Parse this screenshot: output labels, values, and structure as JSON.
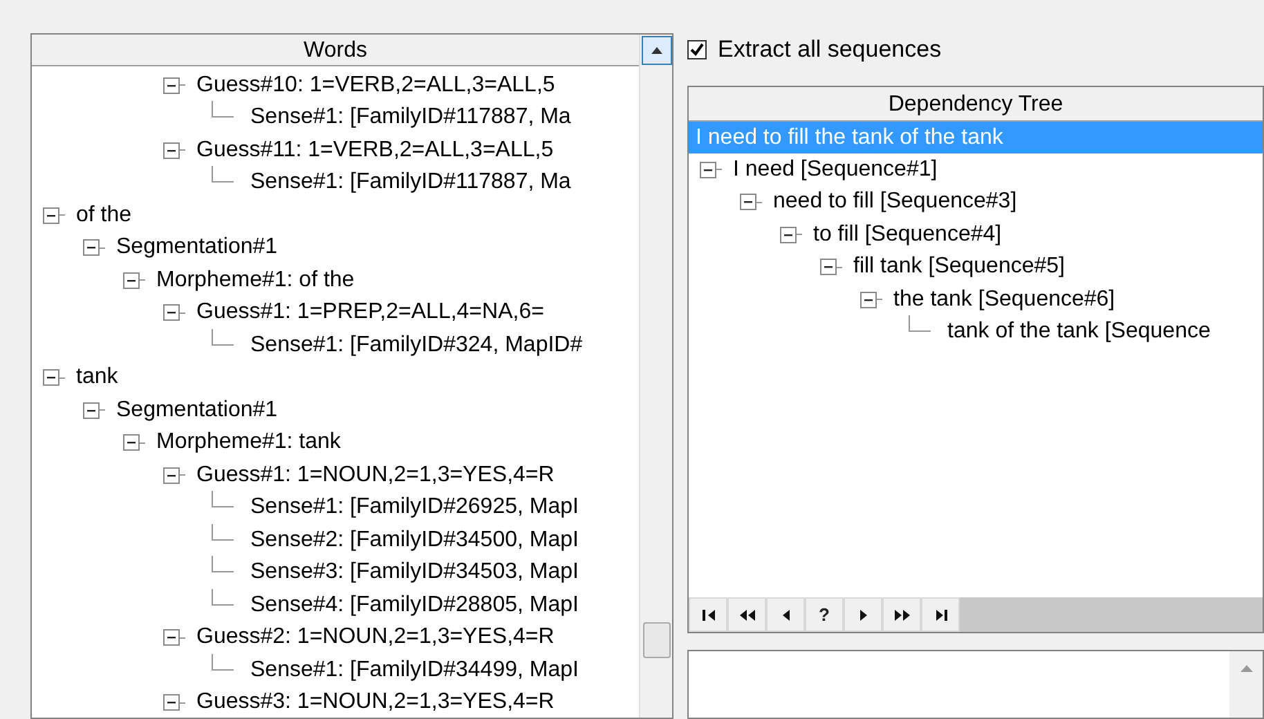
{
  "words_panel": {
    "title": "Words",
    "nodes": [
      {
        "children": [
          {
            "children": [
              {
                "children": [
                  {
                    "label": "Guess#10: 1=VERB,2=ALL,3=ALL,5",
                    "expanded": true,
                    "children": [
                      {
                        "label": "Sense#1: [FamilyID#117887, Ma"
                      }
                    ]
                  },
                  {
                    "label": "Guess#11: 1=VERB,2=ALL,3=ALL,5",
                    "expanded": true,
                    "children": [
                      {
                        "label": "Sense#1: [FamilyID#117887, Ma"
                      }
                    ]
                  }
                ]
              }
            ]
          }
        ]
      },
      {
        "label": "of the",
        "expanded": true,
        "children": [
          {
            "label": "Segmentation#1",
            "expanded": true,
            "children": [
              {
                "label": "Morpheme#1: of the",
                "expanded": true,
                "children": [
                  {
                    "label": "Guess#1: 1=PREP,2=ALL,4=NA,6=",
                    "expanded": true,
                    "children": [
                      {
                        "label": "Sense#1: [FamilyID#324, MapID#"
                      }
                    ]
                  }
                ]
              }
            ]
          }
        ]
      },
      {
        "label": "tank",
        "expanded": true,
        "children": [
          {
            "label": "Segmentation#1",
            "expanded": true,
            "children": [
              {
                "label": "Morpheme#1: tank",
                "expanded": true,
                "children": [
                  {
                    "label": "Guess#1: 1=NOUN,2=1,3=YES,4=R",
                    "expanded": true,
                    "children": [
                      {
                        "label": "Sense#1: [FamilyID#26925, MapI"
                      },
                      {
                        "label": "Sense#2: [FamilyID#34500, MapI"
                      },
                      {
                        "label": "Sense#3: [FamilyID#34503, MapI"
                      },
                      {
                        "label": "Sense#4: [FamilyID#28805, MapI"
                      }
                    ]
                  },
                  {
                    "label": "Guess#2: 1=NOUN,2=1,3=YES,4=R",
                    "expanded": true,
                    "children": [
                      {
                        "label": "Sense#1: [FamilyID#34499, MapI"
                      }
                    ]
                  },
                  {
                    "label": "Guess#3: 1=NOUN,2=1,3=YES,4=R",
                    "expanded": true
                  }
                ]
              }
            ]
          }
        ]
      }
    ]
  },
  "extract_all": {
    "label": "Extract all sequences",
    "checked": true
  },
  "dependency_panel": {
    "title": "Dependency Tree",
    "sentence": {
      "label": "I need to fill the tank of the tank",
      "selected": true
    },
    "nodes": [
      {
        "label": "I need [Sequence#1]",
        "expanded": true,
        "children": [
          {
            "label": "need to fill [Sequence#3]",
            "expanded": true,
            "children": [
              {
                "label": "to fill [Sequence#4]",
                "expanded": true,
                "children": [
                  {
                    "label": "fill tank [Sequence#5]",
                    "expanded": true,
                    "children": [
                      {
                        "label": "the tank [Sequence#6]",
                        "expanded": true,
                        "children": [
                          {
                            "label": "tank of the tank [Sequence"
                          }
                        ]
                      }
                    ]
                  }
                ]
              }
            ]
          }
        ]
      }
    ],
    "navigator": [
      {
        "kind": "first"
      },
      {
        "kind": "prior-page"
      },
      {
        "kind": "prior"
      },
      {
        "kind": "help",
        "label": "?"
      },
      {
        "kind": "next"
      },
      {
        "kind": "next-page"
      },
      {
        "kind": "last"
      }
    ]
  }
}
